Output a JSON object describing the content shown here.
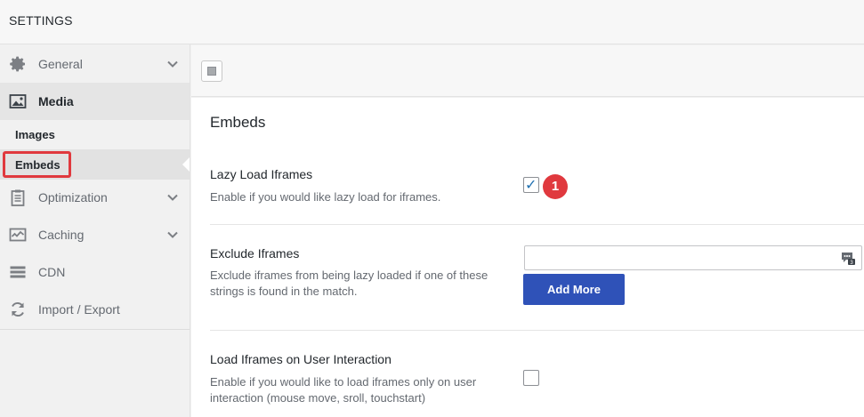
{
  "header": {
    "title": "SETTINGS"
  },
  "sidebar": {
    "items": [
      {
        "label": "General",
        "icon": "gear-icon",
        "expandable": true
      },
      {
        "label": "Media",
        "icon": "image-icon",
        "expandable": false,
        "active": true
      },
      {
        "label": "Optimization",
        "icon": "clipboard-icon",
        "expandable": true
      },
      {
        "label": "Caching",
        "icon": "pulse-icon",
        "expandable": true
      },
      {
        "label": "CDN",
        "icon": "server-stack-icon",
        "expandable": false
      },
      {
        "label": "Import / Export",
        "icon": "refresh-icon",
        "expandable": false
      }
    ],
    "media_subitems": [
      {
        "label": "Images"
      },
      {
        "label": "Embeds",
        "active": true
      }
    ]
  },
  "main": {
    "section_title": "Embeds",
    "settings": {
      "lazy_load": {
        "title": "Lazy Load Iframes",
        "description": "Enable if you would like lazy load for iframes.",
        "checked": true,
        "badge": "1"
      },
      "exclude": {
        "title": "Exclude Iframes",
        "description": "Exclude iframes from being lazy loaded if one of these strings is found in the match.",
        "input_value": "",
        "input_placeholder": "",
        "add_more_label": "Add More"
      },
      "user_interaction": {
        "title": "Load Iframes on User Interaction",
        "description": "Enable if you would like to load iframes only on user interaction (mouse move, sroll, touchstart)",
        "checked": false
      }
    }
  },
  "colors": {
    "accent_blue": "#2f52b8",
    "highlight_red": "#e0393e",
    "check_blue": "#2271b1"
  }
}
